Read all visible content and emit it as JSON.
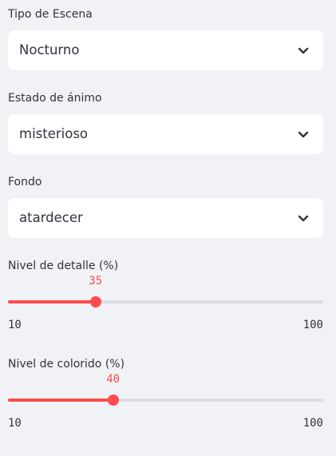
{
  "scene_type": {
    "label": "Tipo de Escena",
    "value": "Nocturno"
  },
  "mood": {
    "label": "Estado de ánimo",
    "value": "misterioso"
  },
  "background": {
    "label": "Fondo",
    "value": "atardecer"
  },
  "detail_slider": {
    "label": "Nivel de detalle (%)",
    "value": 35,
    "min": 10,
    "max": 100
  },
  "color_slider": {
    "label": "Nivel de colorido (%)",
    "value": 40,
    "min": 10,
    "max": 100
  },
  "colors": {
    "accent": "#ff4b4b",
    "track": "#dcdde4",
    "background": "#f0f2f6",
    "field": "#ffffff",
    "text": "#31333f"
  },
  "icons": {
    "dropdown": "chevron-down-icon"
  }
}
